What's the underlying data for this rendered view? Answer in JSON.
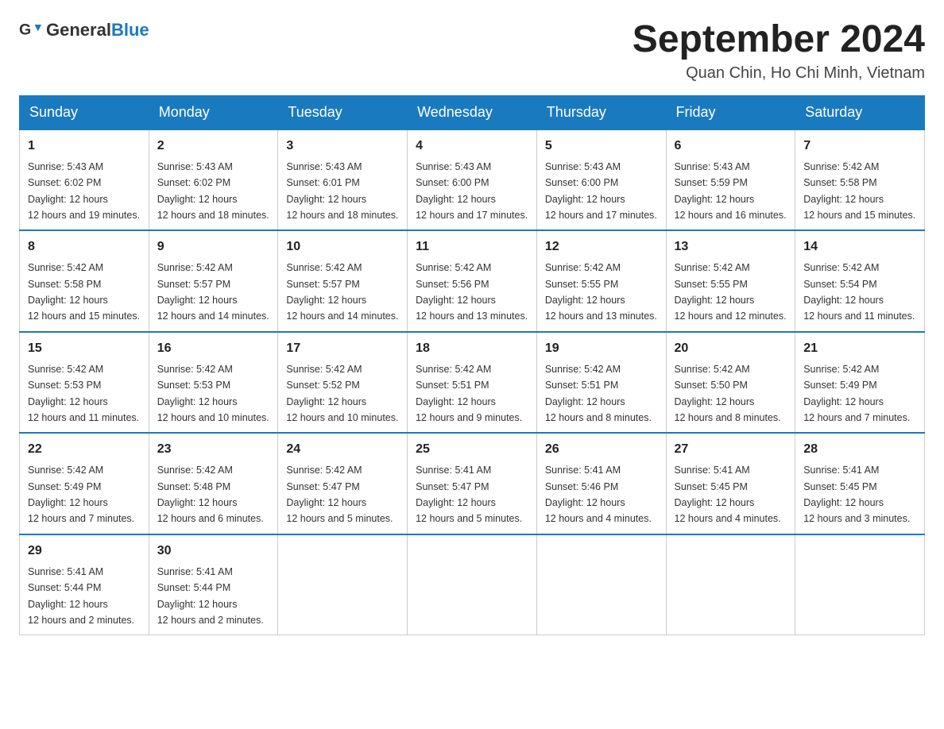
{
  "header": {
    "logo_general": "General",
    "logo_blue": "Blue",
    "title": "September 2024",
    "location": "Quan Chin, Ho Chi Minh, Vietnam"
  },
  "days_of_week": [
    "Sunday",
    "Monday",
    "Tuesday",
    "Wednesday",
    "Thursday",
    "Friday",
    "Saturday"
  ],
  "weeks": [
    [
      {
        "day": "1",
        "sunrise": "5:43 AM",
        "sunset": "6:02 PM",
        "daylight": "12 hours and 19 minutes."
      },
      {
        "day": "2",
        "sunrise": "5:43 AM",
        "sunset": "6:02 PM",
        "daylight": "12 hours and 18 minutes."
      },
      {
        "day": "3",
        "sunrise": "5:43 AM",
        "sunset": "6:01 PM",
        "daylight": "12 hours and 18 minutes."
      },
      {
        "day": "4",
        "sunrise": "5:43 AM",
        "sunset": "6:00 PM",
        "daylight": "12 hours and 17 minutes."
      },
      {
        "day": "5",
        "sunrise": "5:43 AM",
        "sunset": "6:00 PM",
        "daylight": "12 hours and 17 minutes."
      },
      {
        "day": "6",
        "sunrise": "5:43 AM",
        "sunset": "5:59 PM",
        "daylight": "12 hours and 16 minutes."
      },
      {
        "day": "7",
        "sunrise": "5:42 AM",
        "sunset": "5:58 PM",
        "daylight": "12 hours and 15 minutes."
      }
    ],
    [
      {
        "day": "8",
        "sunrise": "5:42 AM",
        "sunset": "5:58 PM",
        "daylight": "12 hours and 15 minutes."
      },
      {
        "day": "9",
        "sunrise": "5:42 AM",
        "sunset": "5:57 PM",
        "daylight": "12 hours and 14 minutes."
      },
      {
        "day": "10",
        "sunrise": "5:42 AM",
        "sunset": "5:57 PM",
        "daylight": "12 hours and 14 minutes."
      },
      {
        "day": "11",
        "sunrise": "5:42 AM",
        "sunset": "5:56 PM",
        "daylight": "12 hours and 13 minutes."
      },
      {
        "day": "12",
        "sunrise": "5:42 AM",
        "sunset": "5:55 PM",
        "daylight": "12 hours and 13 minutes."
      },
      {
        "day": "13",
        "sunrise": "5:42 AM",
        "sunset": "5:55 PM",
        "daylight": "12 hours and 12 minutes."
      },
      {
        "day": "14",
        "sunrise": "5:42 AM",
        "sunset": "5:54 PM",
        "daylight": "12 hours and 11 minutes."
      }
    ],
    [
      {
        "day": "15",
        "sunrise": "5:42 AM",
        "sunset": "5:53 PM",
        "daylight": "12 hours and 11 minutes."
      },
      {
        "day": "16",
        "sunrise": "5:42 AM",
        "sunset": "5:53 PM",
        "daylight": "12 hours and 10 minutes."
      },
      {
        "day": "17",
        "sunrise": "5:42 AM",
        "sunset": "5:52 PM",
        "daylight": "12 hours and 10 minutes."
      },
      {
        "day": "18",
        "sunrise": "5:42 AM",
        "sunset": "5:51 PM",
        "daylight": "12 hours and 9 minutes."
      },
      {
        "day": "19",
        "sunrise": "5:42 AM",
        "sunset": "5:51 PM",
        "daylight": "12 hours and 8 minutes."
      },
      {
        "day": "20",
        "sunrise": "5:42 AM",
        "sunset": "5:50 PM",
        "daylight": "12 hours and 8 minutes."
      },
      {
        "day": "21",
        "sunrise": "5:42 AM",
        "sunset": "5:49 PM",
        "daylight": "12 hours and 7 minutes."
      }
    ],
    [
      {
        "day": "22",
        "sunrise": "5:42 AM",
        "sunset": "5:49 PM",
        "daylight": "12 hours and 7 minutes."
      },
      {
        "day": "23",
        "sunrise": "5:42 AM",
        "sunset": "5:48 PM",
        "daylight": "12 hours and 6 minutes."
      },
      {
        "day": "24",
        "sunrise": "5:42 AM",
        "sunset": "5:47 PM",
        "daylight": "12 hours and 5 minutes."
      },
      {
        "day": "25",
        "sunrise": "5:41 AM",
        "sunset": "5:47 PM",
        "daylight": "12 hours and 5 minutes."
      },
      {
        "day": "26",
        "sunrise": "5:41 AM",
        "sunset": "5:46 PM",
        "daylight": "12 hours and 4 minutes."
      },
      {
        "day": "27",
        "sunrise": "5:41 AM",
        "sunset": "5:45 PM",
        "daylight": "12 hours and 4 minutes."
      },
      {
        "day": "28",
        "sunrise": "5:41 AM",
        "sunset": "5:45 PM",
        "daylight": "12 hours and 3 minutes."
      }
    ],
    [
      {
        "day": "29",
        "sunrise": "5:41 AM",
        "sunset": "5:44 PM",
        "daylight": "12 hours and 2 minutes."
      },
      {
        "day": "30",
        "sunrise": "5:41 AM",
        "sunset": "5:44 PM",
        "daylight": "12 hours and 2 minutes."
      },
      null,
      null,
      null,
      null,
      null
    ]
  ]
}
